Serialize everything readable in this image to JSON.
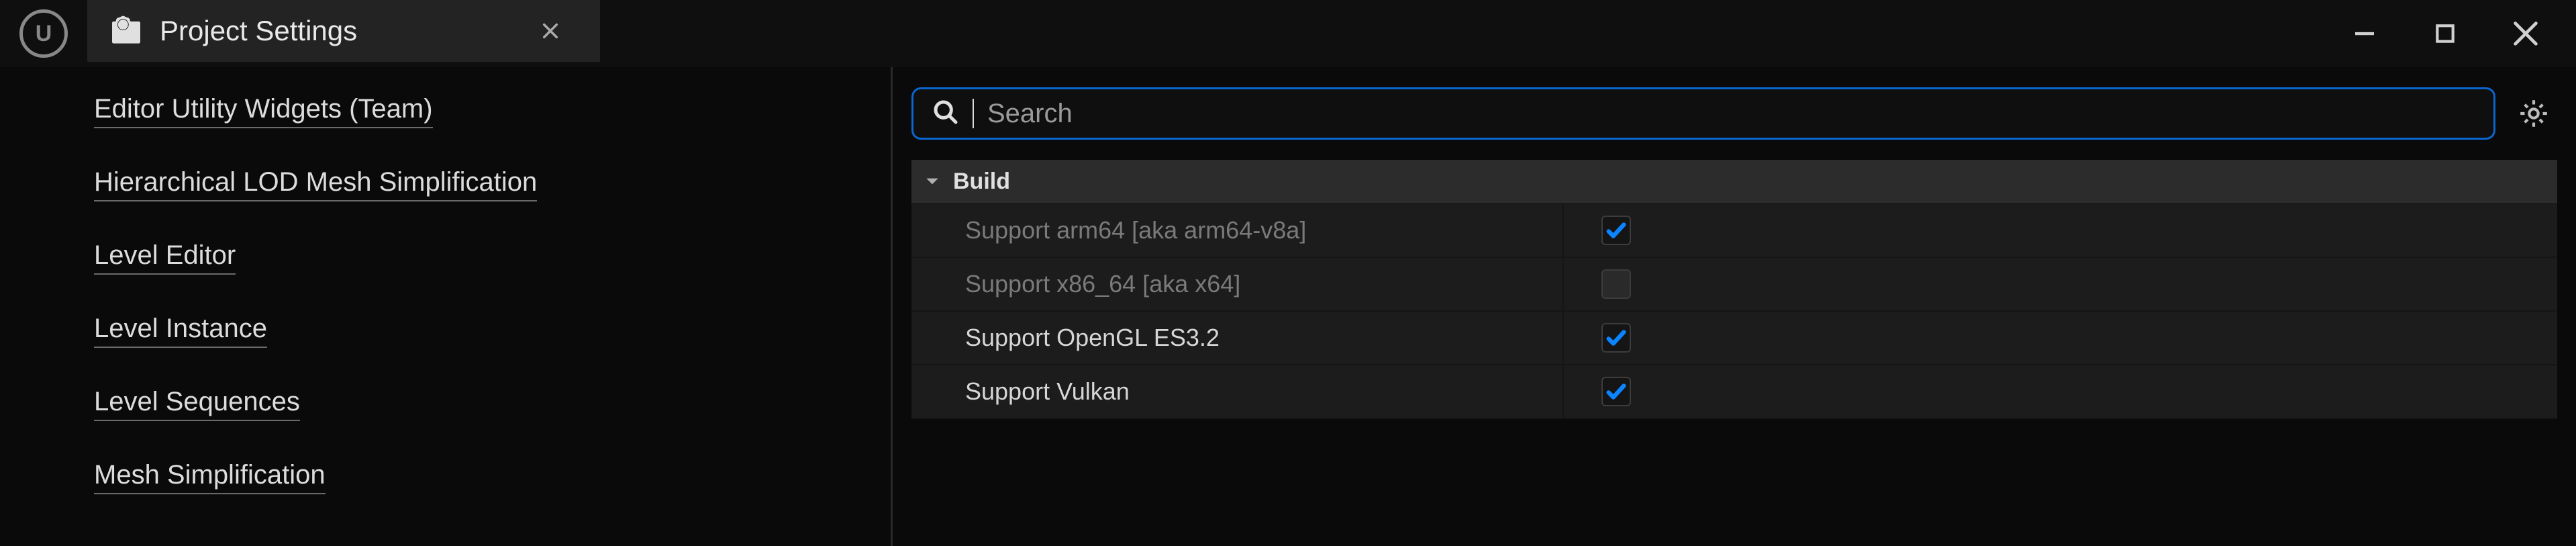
{
  "tab": {
    "title": "Project Settings"
  },
  "sidebar": {
    "items": [
      {
        "label": "Editor Utility Widgets (Team)"
      },
      {
        "label": "Hierarchical LOD Mesh Simplification"
      },
      {
        "label": "Level Editor"
      },
      {
        "label": "Level Instance"
      },
      {
        "label": "Level Sequences"
      },
      {
        "label": "Mesh Simplification"
      }
    ]
  },
  "search": {
    "placeholder": "Search"
  },
  "section": {
    "header": "Build"
  },
  "props": [
    {
      "label": "Support arm64 [aka arm64-v8a]",
      "checked": true,
      "dim": true
    },
    {
      "label": "Support x86_64 [aka x64]",
      "checked": false,
      "dim": true
    },
    {
      "label": "Support OpenGL ES3.2",
      "checked": true,
      "dim": false
    },
    {
      "label": "Support Vulkan",
      "checked": true,
      "dim": false
    }
  ]
}
